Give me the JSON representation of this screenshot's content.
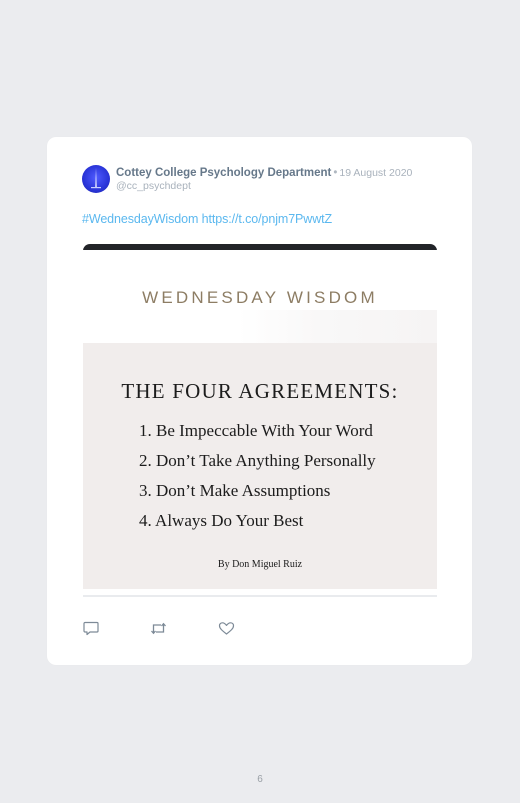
{
  "post": {
    "author_name": "Cottey College Psychology Department",
    "separator": "•",
    "date": "19 August 2020",
    "handle": "@cc_psychdept",
    "hashtag": "#WednesdayWisdom",
    "link": "https://t.co/pnjm7PwwtZ"
  },
  "image": {
    "header": "WEDNESDAY WISDOM",
    "heading": "THE FOUR AGREEMENTS:",
    "agreements": [
      "1. Be Impeccable With Your Word",
      "2. Don’t Take Anything Personally",
      "3. Don’t Make Assumptions",
      "4. Always Do Your Best"
    ],
    "byline": "By Don Miguel Ruiz"
  },
  "actions": {
    "reply_icon": "comment-icon",
    "retweet_icon": "retweet-icon",
    "like_icon": "heart-icon"
  },
  "footer": {
    "page_number": "6"
  },
  "colors": {
    "link": "#5bb8ef",
    "author": "#66788a",
    "muted": "#a9b2bc",
    "card": "#ffffff",
    "background": "#ebecef"
  }
}
